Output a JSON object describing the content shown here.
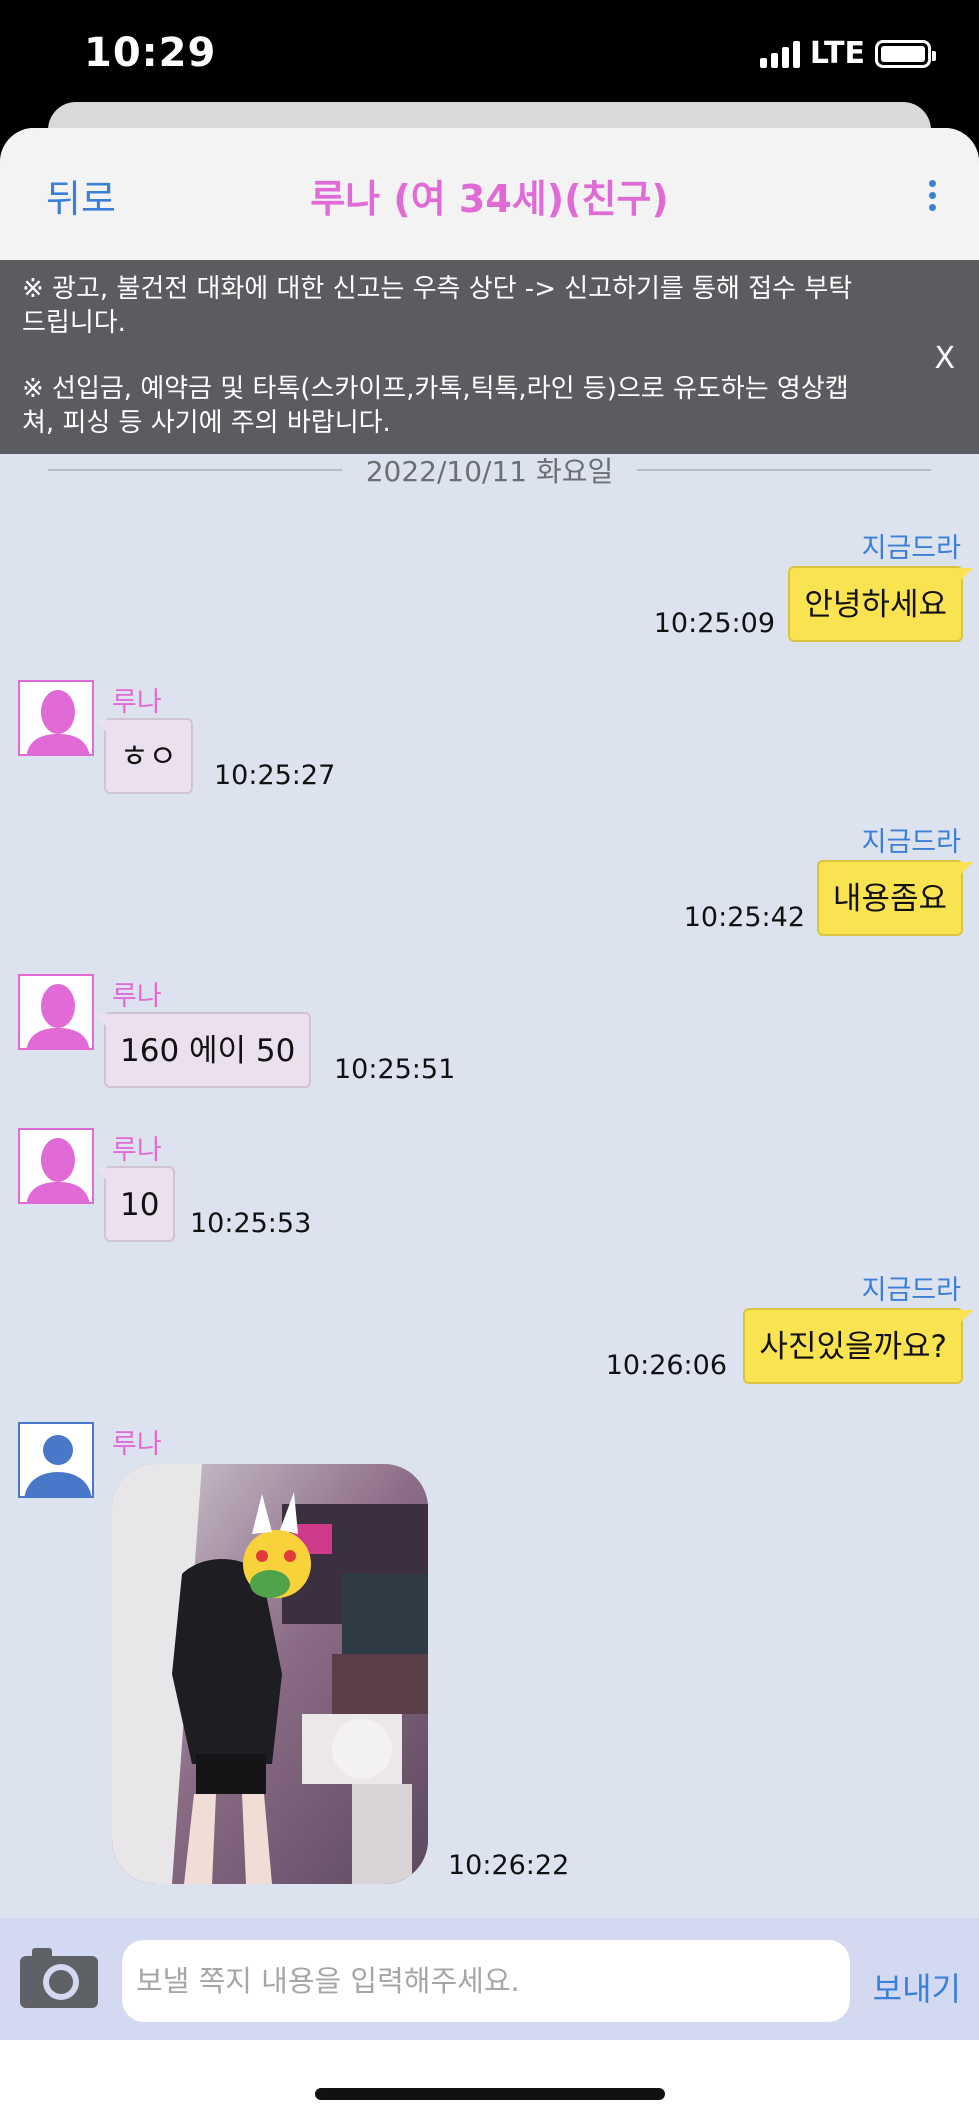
{
  "status_bar": {
    "time": "10:29",
    "network": "LTE"
  },
  "nav": {
    "back_label": "뒤로",
    "title": "루나 (여 34세)(친구)",
    "more_icon": "more-vertical-icon"
  },
  "notice": {
    "line1": "※ 광고, 불건전 대화에 대한 신고는 우측 상단 -> 신고하기를 통해 접수 부탁 드립니다.",
    "line2": "※ 선입금, 예약금 및 타톡(스카이프,카톡,틱톡,라인 등)으로 유도하는 영상캡쳐, 피싱 등 사기에 주의 바랍니다.",
    "close_label": "X"
  },
  "date_separator": "2022/10/11 화요일",
  "messages": [
    {
      "direction": "out",
      "sender": "지금드라",
      "text": "안녕하세요",
      "time": "10:25:09"
    },
    {
      "direction": "in",
      "sender": "루나",
      "text": "ㅎㅇ",
      "time": "10:25:27"
    },
    {
      "direction": "out",
      "sender": "지금드라",
      "text": "내용좀요",
      "time": "10:25:42"
    },
    {
      "direction": "in",
      "sender": "루나",
      "text": "160 에이 50",
      "time": "10:25:51"
    },
    {
      "direction": "in",
      "sender": "루나",
      "text": "10",
      "time": "10:25:53"
    },
    {
      "direction": "out",
      "sender": "지금드라",
      "text": "사진있을까요?",
      "time": "10:26:06"
    },
    {
      "direction": "in",
      "sender": "루나",
      "type": "photo",
      "time": "10:26:22"
    }
  ],
  "composer": {
    "placeholder": "보낼 쪽지 내용을 입력해주세요.",
    "send_label": "보내기",
    "camera_icon": "camera-icon"
  },
  "colors": {
    "outgoing_bubble": "#fae350",
    "incoming_bubble": "#ebe0ee",
    "accent_blue": "#3a7fd8",
    "accent_pink": "#e06bd6",
    "chat_bg": "#dde2ef"
  }
}
